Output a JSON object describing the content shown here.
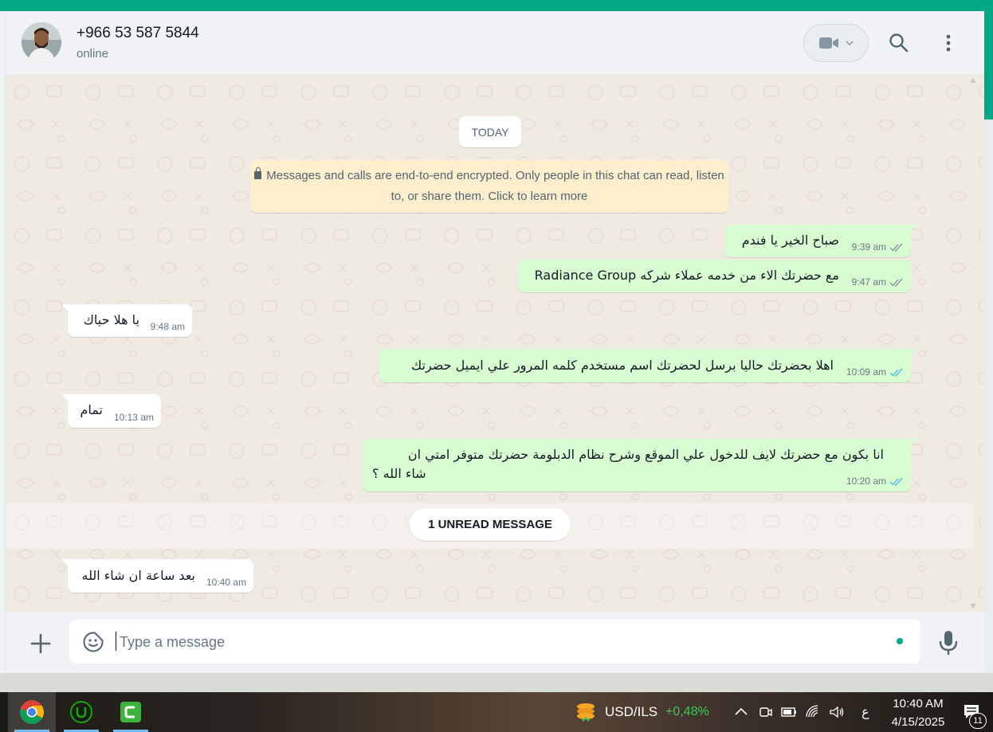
{
  "header": {
    "contact_name": "+966 53 587 5844",
    "status": "online"
  },
  "chat": {
    "date_chip": "TODAY",
    "encryption_notice": "Messages and calls are end-to-end encrypted. Only people in this chat can read, listen to, or share them. Click to learn more",
    "messages": [
      {
        "dir": "out",
        "text": "صباح الخير يا فندم",
        "time": "9:39 am",
        "status": "delivered"
      },
      {
        "dir": "out",
        "text": "مع حضرتك الاء من خدمه عملاء شركه Radiance Group",
        "time": "9:47 am",
        "status": "delivered"
      },
      {
        "dir": "in",
        "text": "يا هلا حياك",
        "time": "9:48 am"
      },
      {
        "dir": "out",
        "text": "اهلا بحضرتك حاليا برسل لحضرتك اسم مستخدم كلمه المرور علي ايميل حضرتك",
        "time": "10:09 am",
        "status": "read"
      },
      {
        "dir": "in",
        "text": "تمام",
        "time": "10:13 am"
      },
      {
        "dir": "out",
        "text_line1": "انا بكون مع حضرتك لايف للدخول علي الموقع وشرح نظام الدبلومة حضرتك متوفر امتي ان",
        "text_line2": "شاء الله ؟",
        "time": "10:20 am",
        "status": "read"
      },
      {
        "dir": "in",
        "text": "بعد ساعة ان شاء الله",
        "time": "10:40 am"
      }
    ],
    "unread_label": "1 UNREAD MESSAGE"
  },
  "composer": {
    "placeholder": "Type a message"
  },
  "taskbar": {
    "ticker_symbol": "USD/ILS",
    "ticker_change": "+0,48%",
    "ticker_color": "#3cc85a",
    "input_lang": "ع",
    "time": "10:40 AM",
    "date": "4/15/2025",
    "notification_count": "11"
  },
  "colors": {
    "accent": "#00a884",
    "outgoing_bubble": "#d9fdd3",
    "incoming_bubble": "#ffffff",
    "read_tick": "#53bdeb",
    "delivered_tick": "#8696a0"
  }
}
